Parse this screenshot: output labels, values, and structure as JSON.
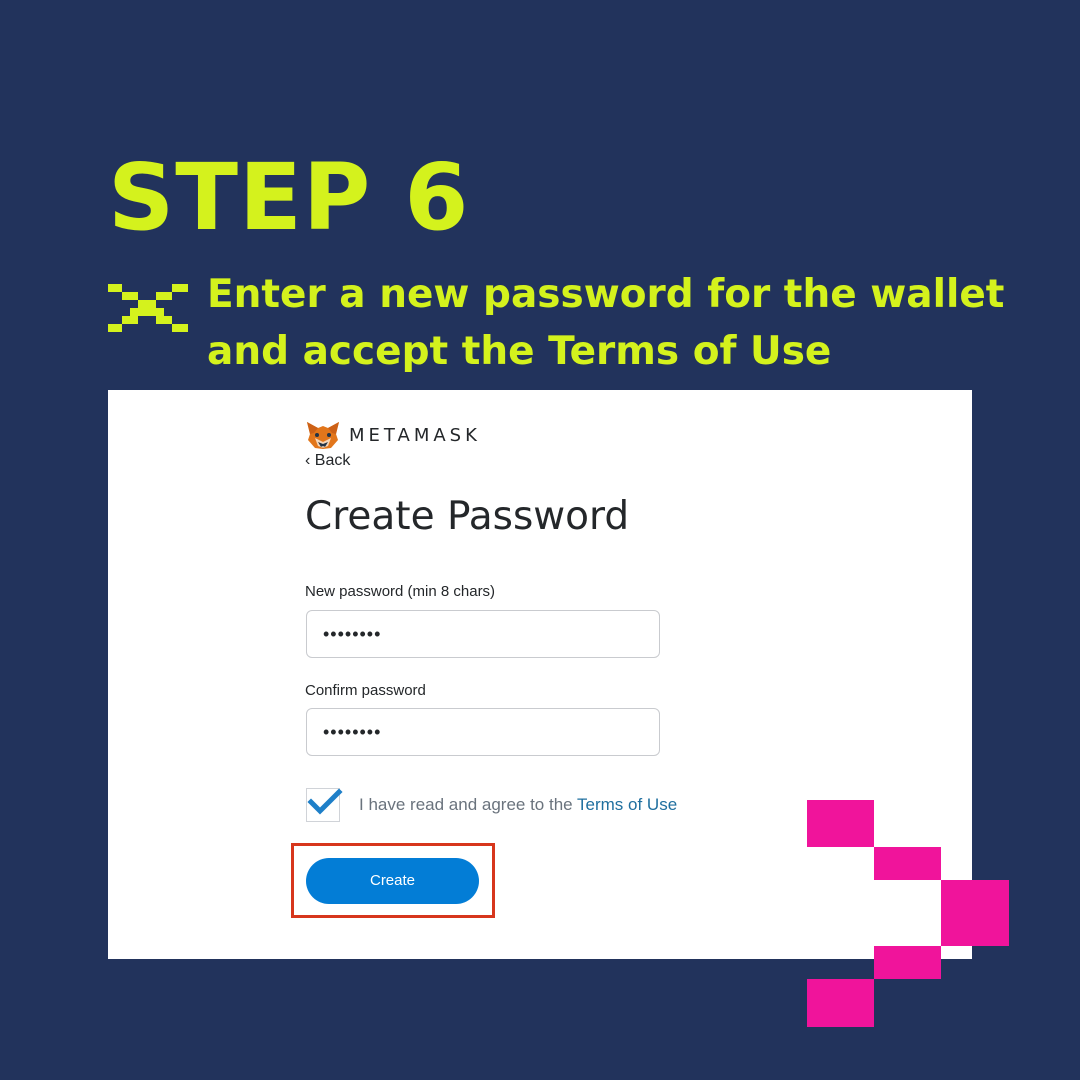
{
  "step": {
    "title": "STEP 6",
    "instruction": "Enter a new password for the wallet and accept the Terms of Use"
  },
  "app": {
    "logo_text": "METAMASK",
    "back_label": "‹ Back",
    "page_title": "Create Password"
  },
  "form": {
    "new_password_label": "New password (min 8 chars)",
    "new_password_value": "••••••••",
    "confirm_password_label": "Confirm password",
    "confirm_password_value": "••••••••",
    "agree_text": "I have read and agree to the ",
    "terms_link": "Terms of Use",
    "agree_checked": true,
    "create_label": "Create"
  },
  "colors": {
    "background": "#22335c",
    "accent_lime": "#d4f21d",
    "accent_pink": "#f0149b",
    "button_blue": "#037dd6",
    "highlight_red": "#d7361c"
  },
  "icons": [
    "pixel-x-icon",
    "fox-logo-icon",
    "checkmark-icon"
  ]
}
